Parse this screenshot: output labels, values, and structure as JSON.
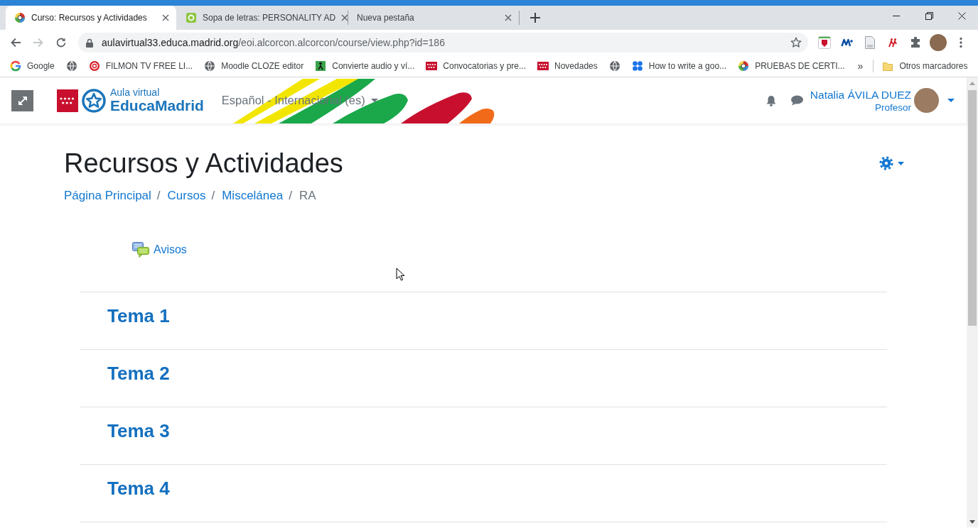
{
  "tabs": [
    {
      "title": "Curso: Recursos y Actividades",
      "kind": "emblem",
      "selected": true
    },
    {
      "title": "Sopa de letras: PERSONALITY AD",
      "kind": "badge",
      "selected": false
    },
    {
      "title": "Nueva pestaña",
      "kind": "blank",
      "selected": false
    }
  ],
  "toolbar": {
    "nav_buttons": [
      {
        "kind": "back",
        "disabled": false
      },
      {
        "kind": "forward",
        "disabled": true
      },
      {
        "kind": "reload",
        "disabled": false
      }
    ],
    "address": {
      "domain": "aulavirtual33.educa.madrid.org",
      "path": "/eoi.alcorcon.alcorcon/course/view.php?id=186"
    }
  },
  "bookmarks": {
    "items": [
      {
        "kind": "ring",
        "label": "Google"
      },
      {
        "kind": "globe"
      },
      {
        "kind": "record",
        "label": "FILMON TV FREE LI..."
      },
      {
        "kind": "globe",
        "label": "Moodle CLOZE editor"
      },
      {
        "kind": "tile",
        "label": "Convierte audio y ví..."
      },
      {
        "kind": "flag",
        "label": "Convocatorias y pre..."
      },
      {
        "kind": "flag",
        "label": "Novedades"
      },
      {
        "kind": "globe"
      },
      {
        "kind": "dots",
        "label": "How to write a goo..."
      },
      {
        "kind": "emblem",
        "label": "PRUEBAS DE CERTI..."
      }
    ],
    "overflow": "»",
    "other": "Otros marcadores"
  },
  "navbar": {
    "logo": {
      "caption": "Aula virtual",
      "name": "EducaMadrid"
    },
    "language": "Español - Internacional (es)",
    "user": {
      "name": "Natalia ÁVILA DUEZ",
      "role": "Profesor"
    }
  },
  "page": {
    "title": "Recursos y Actividades",
    "breadcrumb": {
      "separator": "/",
      "items": [
        {
          "label": "Página Principal",
          "link": true
        },
        {
          "label": "Cursos",
          "link": true
        },
        {
          "label": "Miscelánea",
          "link": true
        },
        {
          "label": "RA",
          "link": false
        }
      ]
    },
    "activities": [
      {
        "kind": "forum",
        "label": "Avisos"
      }
    ],
    "sections": [
      {
        "title": "Tema 1"
      },
      {
        "title": "Tema 2"
      },
      {
        "title": "Tema 3"
      },
      {
        "title": "Tema 4"
      }
    ]
  }
}
